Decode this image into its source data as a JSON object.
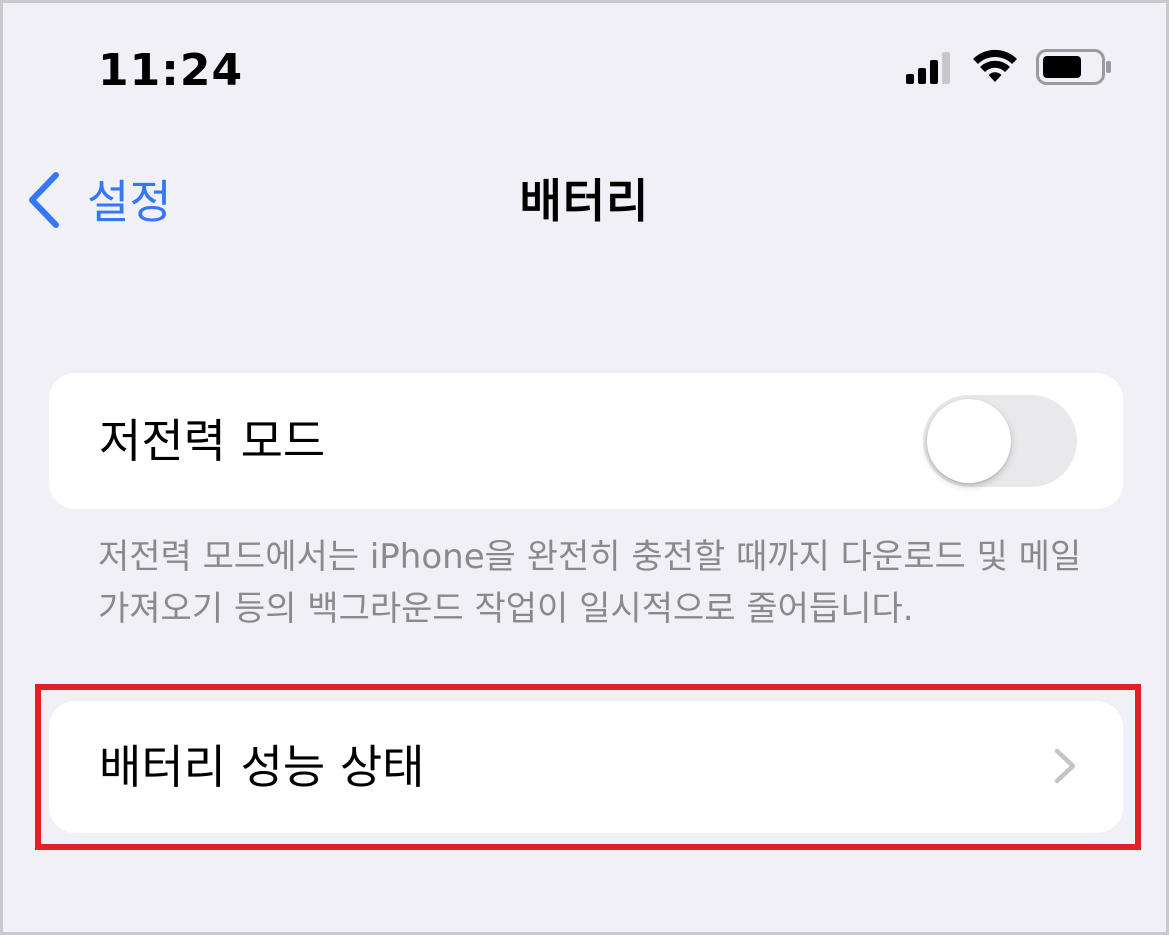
{
  "status_bar": {
    "time": "11:24",
    "icons": [
      "cellular-signal-icon",
      "wifi-icon",
      "battery-icon"
    ]
  },
  "nav": {
    "back_label": "설정",
    "title": "배터리"
  },
  "low_power": {
    "label": "저전력 모드",
    "toggle_on": false,
    "footer": "저전력 모드에서는 iPhone을 완전히 충전할 때까지 다운로드 및 메일 가져오기 등의 백그라운드 작업이 일시적으로 줄어듭니다."
  },
  "battery_health": {
    "label": "배터리 성능 상태"
  },
  "colors": {
    "background": "#f1f0f6",
    "accent": "#3478f6",
    "highlight": "#e81e25",
    "secondary_text": "#8a8a8e"
  }
}
